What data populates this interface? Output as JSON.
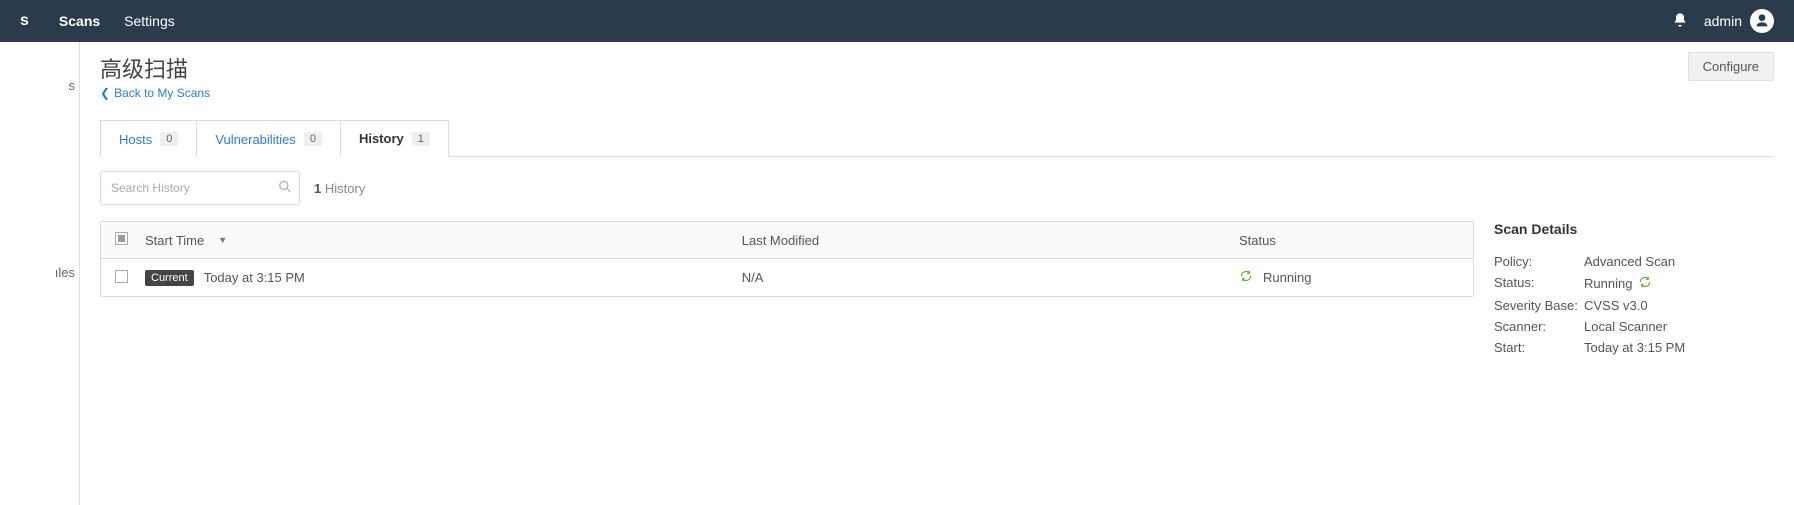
{
  "topbar": {
    "brand": "s",
    "nav": {
      "scans": "Scans",
      "settings": "Settings"
    },
    "user": "admin"
  },
  "sidebar": {
    "items": [
      {
        "label": "s"
      },
      {
        "label": "ıles"
      }
    ]
  },
  "page": {
    "title": "高级扫描",
    "back_label": "Back to My Scans",
    "configure_label": "Configure"
  },
  "tabs": {
    "hosts": {
      "label": "Hosts",
      "count": "0"
    },
    "vulns": {
      "label": "Vulnerabilities",
      "count": "0"
    },
    "history": {
      "label": "History",
      "count": "1"
    }
  },
  "toolbar": {
    "search_placeholder": "Search History",
    "count_num": "1",
    "count_label": "History"
  },
  "table": {
    "headers": {
      "start": "Start Time",
      "modified": "Last Modified",
      "status": "Status"
    },
    "rows": [
      {
        "badge": "Current",
        "start": "Today at 3:15 PM",
        "modified": "N/A",
        "status": "Running"
      }
    ]
  },
  "details": {
    "title": "Scan Details",
    "rows": {
      "policy_k": "Policy:",
      "policy_v": "Advanced Scan",
      "status_k": "Status:",
      "status_v": "Running",
      "severity_k": "Severity Base:",
      "severity_v": "CVSS v3.0",
      "scanner_k": "Scanner:",
      "scanner_v": "Local Scanner",
      "start_k": "Start:",
      "start_v": "Today at 3:15 PM"
    }
  }
}
